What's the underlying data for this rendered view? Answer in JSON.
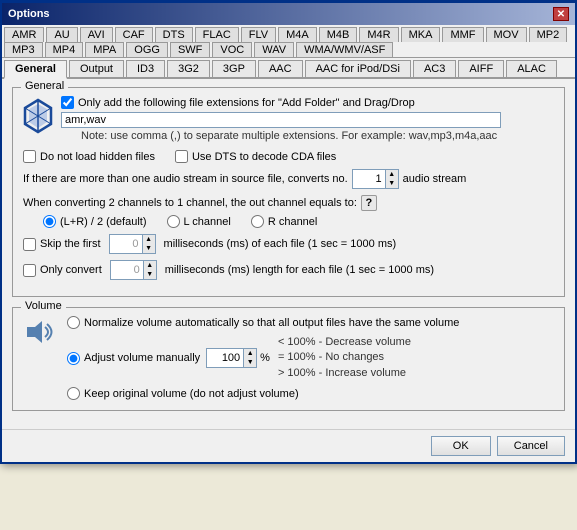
{
  "dialog": {
    "title": "Options",
    "close_label": "✕"
  },
  "format_tabs": [
    "AMR",
    "AU",
    "AVI",
    "CAF",
    "DTS",
    "FLAC",
    "FLV",
    "M4A",
    "M4B",
    "M4R",
    "MKA",
    "MMF",
    "MOV",
    "MP2",
    "MP3",
    "MP4",
    "MPA",
    "OGG",
    "SWF",
    "VOC",
    "WAV",
    "WMA/WMV/ASF"
  ],
  "section_tabs": [
    "General",
    "Output",
    "ID3",
    "3G2",
    "3GP",
    "AAC",
    "AAC for iPod/DSi",
    "AC3",
    "AIFF",
    "ALAC"
  ],
  "general_group_title": "General",
  "general": {
    "add_folder_check_label": "Only add the following file extensions for \"Add Folder\" and Drag/Drop",
    "extensions_value": "amr,wav",
    "note_text": "Note: use comma (,) to separate multiple extensions. For example: wav,mp3,m4a,aac",
    "hidden_files_label": "Do not load hidden files",
    "dts_label": "Use DTS to decode CDA files",
    "audio_stream_label": "If there are more than one audio stream in source file, converts no.",
    "audio_stream_value": "1",
    "audio_stream_suffix": "audio stream",
    "channel_label": "When converting 2 channels to 1 channel, the out channel equals to:",
    "channel_options": [
      "(L+R) / 2 (default)",
      "L channel",
      "R channel"
    ],
    "skip_first_label": "Skip the first",
    "skip_first_value": "0",
    "skip_first_suffix": "milliseconds (ms) of each file (1 sec = 1000 ms)",
    "only_convert_label": "Only convert",
    "only_convert_value": "0",
    "only_convert_suffix": "milliseconds (ms) length for each file (1 sec = 1000 ms)"
  },
  "volume": {
    "group_title": "Volume",
    "normalize_label": "Normalize volume automatically so that all output files have the same volume",
    "adjust_label": "Adjust volume manually",
    "adjust_value": "100",
    "adjust_pct": "%",
    "notes": [
      "< 100% - Decrease volume",
      "= 100% - No changes",
      "> 100% - Increase volume"
    ],
    "keep_original_label": "Keep original volume (do not adjust volume)"
  },
  "footer": {
    "ok_label": "OK",
    "cancel_label": "Cancel"
  }
}
